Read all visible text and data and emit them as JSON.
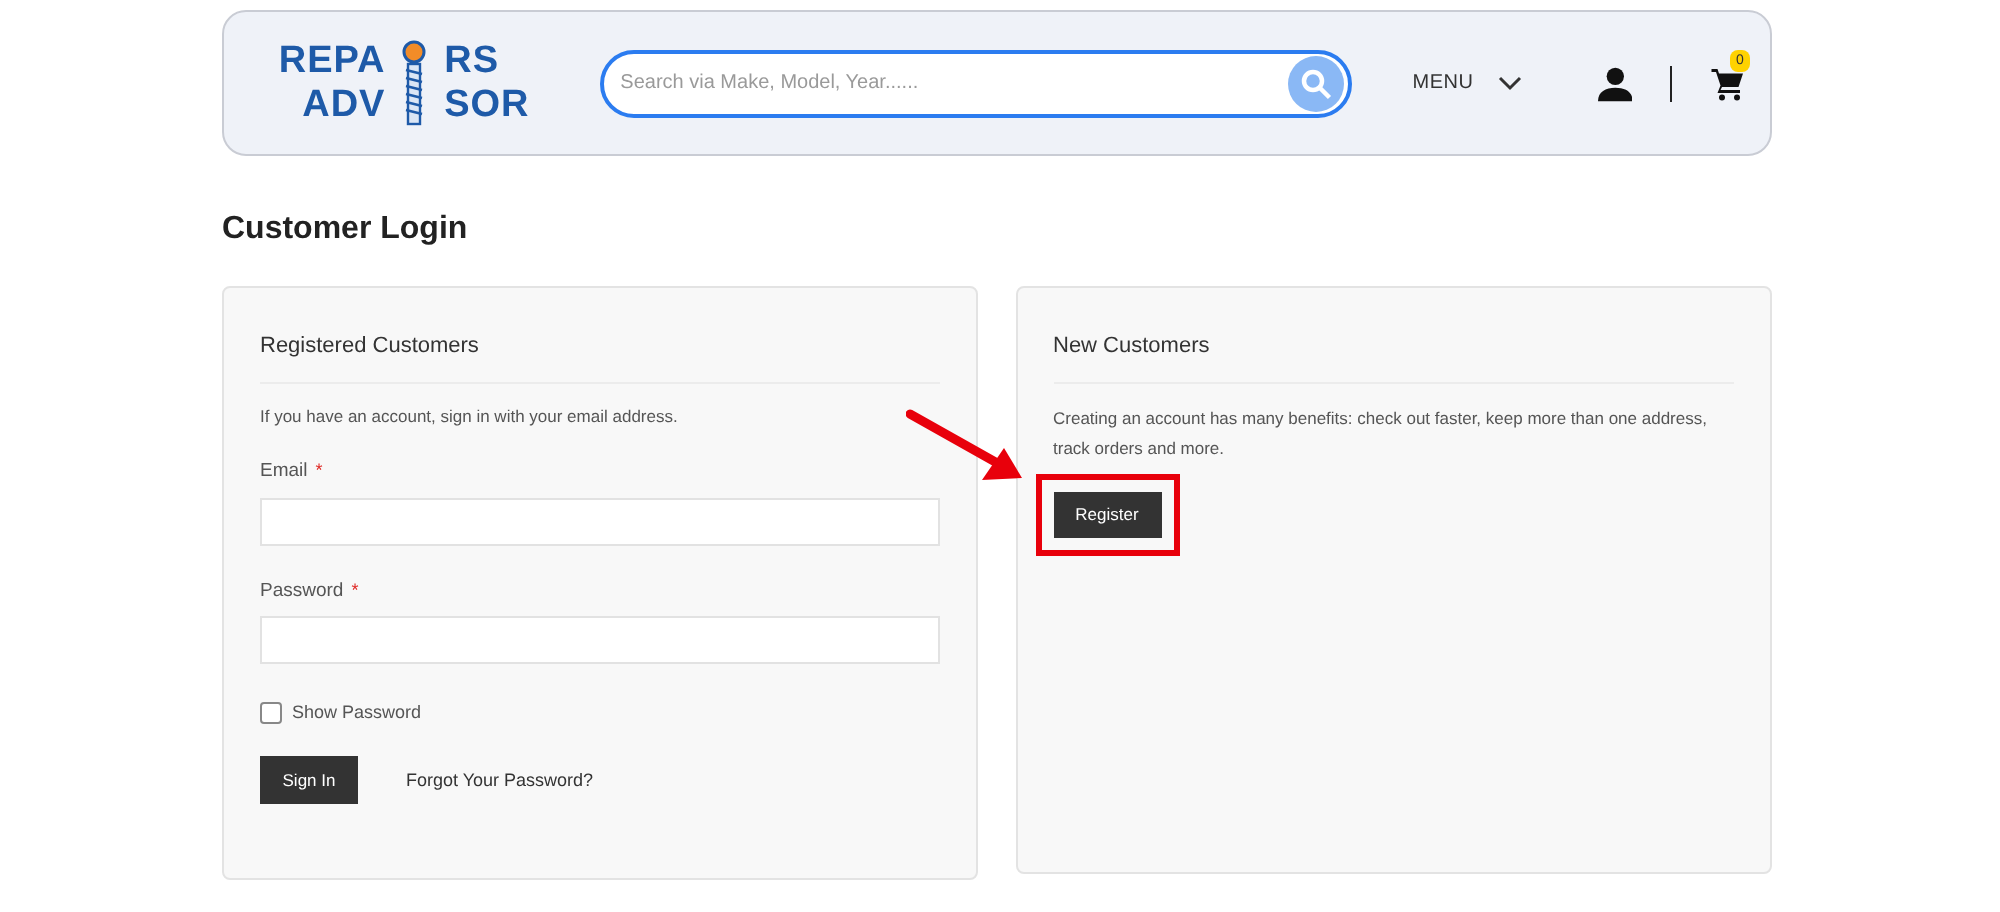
{
  "header": {
    "logo": {
      "top": [
        "REPA",
        "RS"
      ],
      "bottom": [
        "ADV",
        "SOR"
      ]
    },
    "search": {
      "placeholder": "Search via Make, Model, Year......"
    },
    "menu": "MENU",
    "cart_count": "0"
  },
  "page_title": "Customer Login",
  "login": {
    "title": "Registered Customers",
    "intro": "If you have an account, sign in with your email address.",
    "fields": [
      {
        "label": "Email",
        "required_mark": "*"
      },
      {
        "label": "Password",
        "required_mark": "*"
      }
    ],
    "show_password": {
      "label": "Show Password",
      "checked": false
    },
    "button": "Sign In",
    "forgot": "Forgot Your Password?"
  },
  "register": {
    "title": "New Customers",
    "text": "Creating an account has many benefits: check out faster, keep more than one address, track orders and more.",
    "button": "Register",
    "highlighted": true
  }
}
